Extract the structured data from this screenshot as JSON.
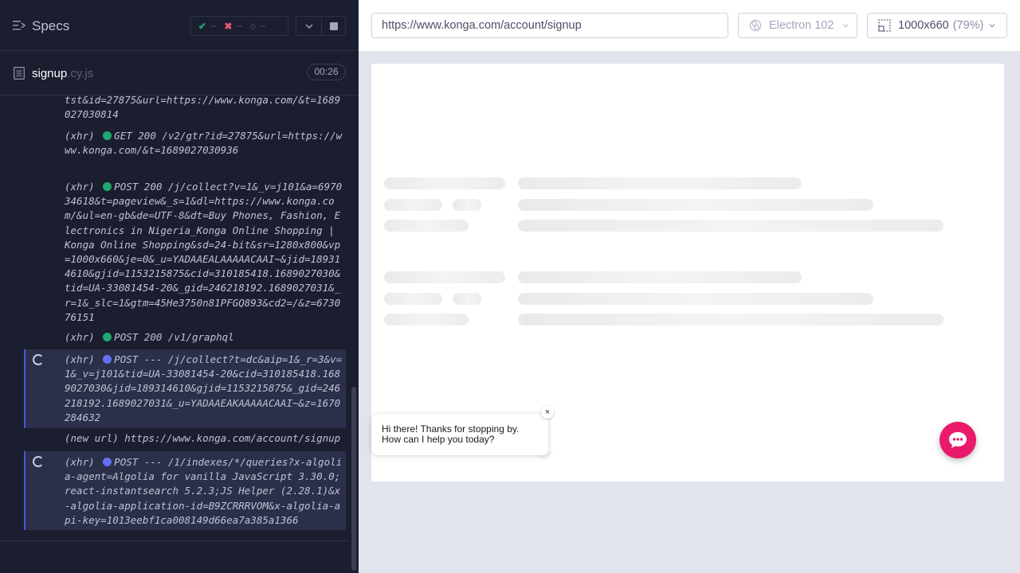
{
  "reporter": {
    "specs_label": "Specs",
    "stats": {
      "passed": "--",
      "failed": "--",
      "pending": "--"
    },
    "file": {
      "name": "signup",
      "ext": ".cy.js",
      "duration": "00:26"
    },
    "commands": [
      {
        "type": "",
        "status": "",
        "text": "tst&id=27875&url=https://www.konga.com/&t=1689027030814",
        "pending": false
      },
      {
        "type": "(xhr)",
        "status": "ok",
        "text": "GET 200 /v2/gtr?id=27875&url=https://www.konga.com/&t=1689027030936",
        "pending": false
      },
      {
        "type": "(xhr)",
        "status": "ok",
        "text": "POST 200 /j/collect?v=1&_v=j101&a=697034618&t=pageview&_s=1&dl=https://www.konga.com/&ul=en-gb&de=UTF-8&dt=Buy Phones, Fashion, Electronics in Nigeria_Konga Online Shopping | Konga Online Shopping&sd=24-bit&sr=1280x800&vp=1000x660&je=0&_u=YADAAEALAAAAACAAI~&jid=189314610&gjid=1153215875&cid=310185418.1689027030&tid=UA-33081454-20&_gid=246218192.1689027031&_r=1&_slc=1&gtm=45He3750n81PFGQ893&cd2=/&z=673076151",
        "pending": false
      },
      {
        "type": "(xhr)",
        "status": "ok",
        "text": "POST 200 /v1/graphql",
        "pending": false
      },
      {
        "type": "(xhr)",
        "status": "wait",
        "text": "POST --- /j/collect?t=dc&aip=1&_r=3&v=1&_v=j101&tid=UA-33081454-20&cid=310185418.1689027030&jid=189314610&gjid=1153215875&_gid=246218192.1689027031&_u=YADAAEAKAAAAACAAI~&z=1670284632",
        "pending": true
      },
      {
        "type": "(new url)",
        "status": "",
        "text": "https://www.konga.com/account/signup",
        "pending": false
      },
      {
        "type": "(xhr)",
        "status": "wait",
        "text": "POST --- /1/indexes/*/queries?x-algolia-agent=Algolia for vanilla JavaScript 3.30.0;react-instantsearch 5.2.3;JS Helper (2.28.1)&x-algolia-application-id=B9ZCRRRVOM&x-algolia-api-key=1013eebf1ca008149d66ea7a385a1366",
        "pending": true
      }
    ]
  },
  "aut": {
    "url": "https://www.konga.com/account/signup",
    "browser": "Electron 102",
    "viewport": "1000x660",
    "scale": "(79%)"
  },
  "chat": {
    "message_line1": "Hi there! Thanks for stopping by.",
    "message_line2": "How can I help you today?",
    "close": "×"
  },
  "colors": {
    "accent": "#4956e3",
    "pass": "#1fa971",
    "fail": "#e45770",
    "chat_brand": "#ea1a6a"
  }
}
